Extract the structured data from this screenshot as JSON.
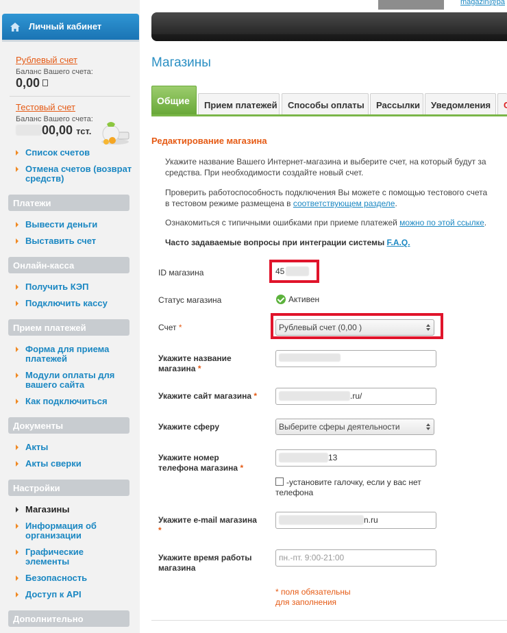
{
  "header": {
    "user_email": "magazin@pa"
  },
  "sidebar": {
    "cabinet_title": "Личный кабинет",
    "accounts": [
      {
        "name": "Рублевый счет",
        "balance_label": "Баланс Вашего счета:",
        "balance": "0,00",
        "currency": ""
      },
      {
        "name": "Тестовый счет",
        "balance_label": "Баланс Вашего счета:",
        "balance": "00,00",
        "currency": "тст."
      }
    ],
    "account_links": [
      "Список счетов",
      "Отмена счетов (возврат средств)"
    ],
    "sections": [
      {
        "title": "Платежи",
        "items": [
          "Вывести деньги",
          "Выставить счет"
        ]
      },
      {
        "title": "Онлайн-касса",
        "items": [
          "Получить КЭП",
          "Подключить кассу"
        ]
      },
      {
        "title": "Прием платежей",
        "items": [
          "Форма для приема платежей",
          "Модули оплаты для вашего сайта",
          "Как подключиться"
        ]
      },
      {
        "title": "Документы",
        "items": [
          "Акты",
          "Акты сверки"
        ]
      },
      {
        "title": "Настройки",
        "items": [
          "Магазины",
          "Информация об организации",
          "Графические элементы",
          "Безопасность",
          "Доступ к API"
        ]
      },
      {
        "title": "Дополнительно",
        "items": []
      }
    ]
  },
  "main": {
    "page_title": "Магазины",
    "tabs": [
      "Общие",
      "Прием платежей",
      "Способы оплаты",
      "Рассылки",
      "Уведомления",
      "С"
    ],
    "section_title": "Редактирование магазина",
    "intro": {
      "p1_line1": "Укажите название Вашего Интернет-магазина и выберите счет, на который будут за",
      "p1_line2": "средства. При необходимости создайте новый счет.",
      "p2_line1": "Проверить работоспособность подключения Вы можете с помощью тестового счета",
      "p2_line2_prefix": "в тестовом режиме размещена в ",
      "p2_link": "соответствующем разделе",
      "p2_suffix": ".",
      "p3_prefix": "Ознакомиться с типичными ошибками при приеме платежей ",
      "p3_link": "можно по этой ссылке",
      "p3_suffix": ".",
      "faq_prefix": "Часто задаваемые вопросы при интеграции системы ",
      "faq_link": "F.A.Q."
    },
    "form": {
      "shop_id_label": "ID магазина",
      "shop_id_value": "45",
      "status_label": "Статус магазина",
      "status_value": "Активен",
      "account_label": "Счет",
      "account_value": "Рублевый счет (0,00 )",
      "name_label_line1": "Укажите название",
      "name_label_line2": "магазина",
      "site_label": "Укажите сайт магазина",
      "site_value_suffix": ".ru/",
      "sphere_label": "Укажите сферу",
      "sphere_value": "Выберите сферы деятельности",
      "phone_label_line1": "Укажите номер",
      "phone_label_line2": "телефона магазина",
      "phone_value_suffix": "13",
      "no_phone_text": "-установите галочку, если у вас нет телефона",
      "email_label": "Укажите e-mail магазина",
      "email_value_suffix": "n.ru",
      "hours_label_line1": "Укажите время работы",
      "hours_label_line2": "магазина",
      "hours_placeholder": "пн.-пт. 9:00-21:00",
      "required_mark": "*",
      "required_note_line1": "* поля обязательны",
      "required_note_line2": "для заполнения"
    }
  },
  "colors": {
    "accent_blue": "#1a87c2",
    "accent_orange": "#e55a14",
    "tab_green": "#7ab648",
    "highlight_red": "#e0142b"
  }
}
